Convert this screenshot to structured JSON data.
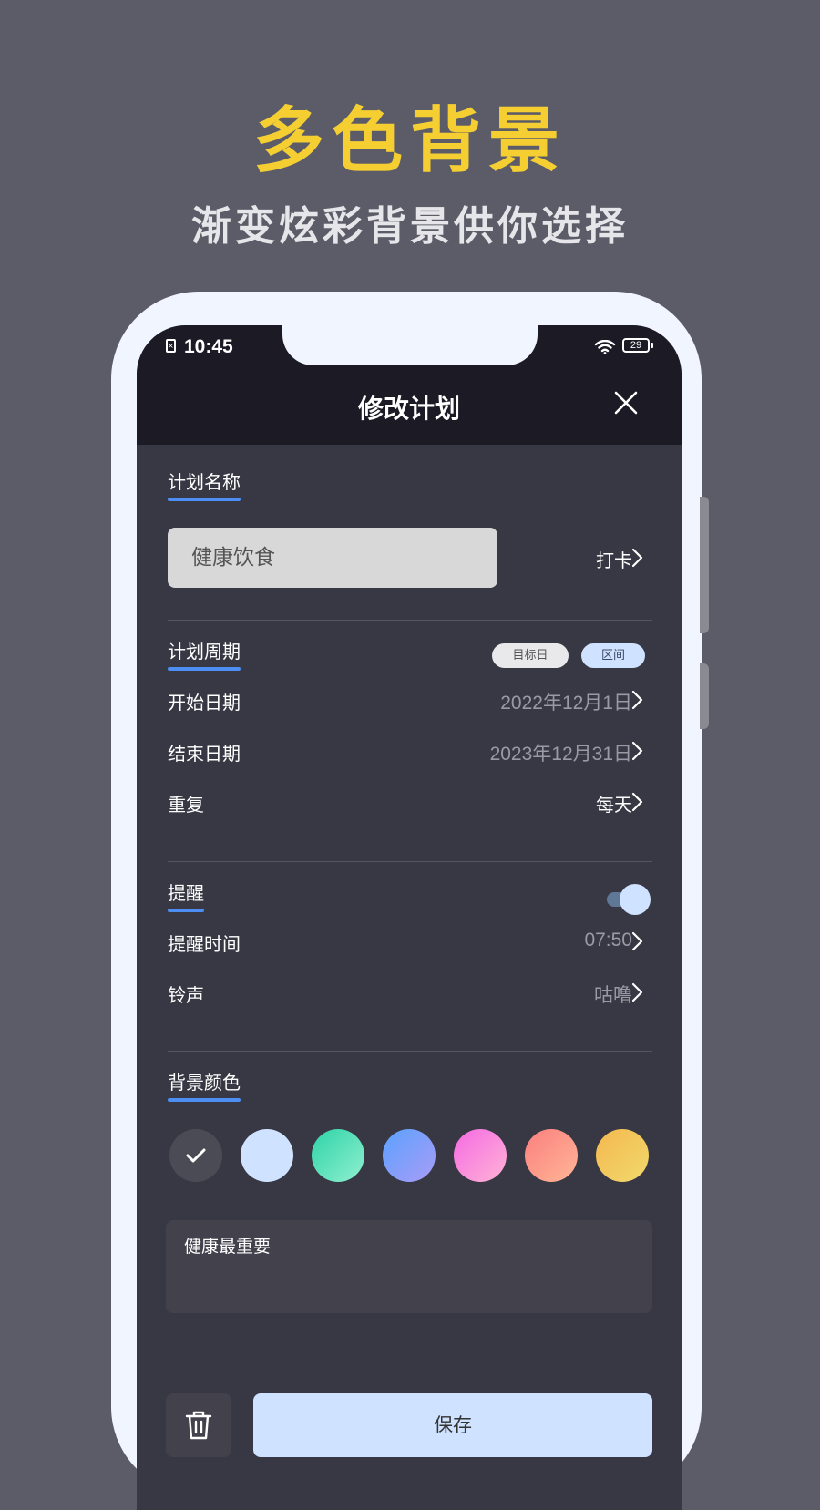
{
  "promo": {
    "headline": "多色背景",
    "subline": "渐变炫彩背景供你选择"
  },
  "status_bar": {
    "time": "10:45",
    "battery": "29",
    "icons": [
      "sim-icon",
      "wifi-icon",
      "battery-icon"
    ]
  },
  "header": {
    "title": "修改计划",
    "close_icon": "close-icon"
  },
  "plan_name": {
    "label": "计划名称",
    "value": "健康饮食",
    "type_value": "打卡"
  },
  "plan_period": {
    "label": "计划周期",
    "options": [
      "目标日",
      "区间"
    ],
    "selected": "区间",
    "start_label": "开始日期",
    "start_value": "2022年12月1日",
    "end_label": "结束日期",
    "end_value": "2023年12月31日",
    "repeat_label": "重复",
    "repeat_value": "每天"
  },
  "reminder": {
    "label": "提醒",
    "enabled": true,
    "time_label": "提醒时间",
    "time_value": "07:50",
    "ringtone_label": "铃声",
    "ringtone_value": "咕噜"
  },
  "background": {
    "label": "背景颜色",
    "selected_index": 0,
    "swatches": [
      {
        "name": "dark",
        "from": "#4b4b55",
        "to": "#4b4b55"
      },
      {
        "name": "light-blue",
        "from": "#cfe2ff",
        "to": "#cfe2ff"
      },
      {
        "name": "teal",
        "from": "#2fd3a7",
        "to": "#8ff0d0"
      },
      {
        "name": "blue",
        "from": "#5aa2ff",
        "to": "#a99cf6"
      },
      {
        "name": "pink",
        "from": "#f56ae3",
        "to": "#ffb3d6"
      },
      {
        "name": "coral",
        "from": "#fb7f7f",
        "to": "#ffb696"
      },
      {
        "name": "yellow",
        "from": "#f4b84f",
        "to": "#f1d96c"
      }
    ]
  },
  "note": {
    "value": "健康最重要"
  },
  "actions": {
    "delete_icon": "trash-icon",
    "save_label": "保存"
  },
  "colors": {
    "accent_underline": "#4d8ef3",
    "headline": "#f5cf32",
    "primary_button": "#cfe2ff"
  }
}
